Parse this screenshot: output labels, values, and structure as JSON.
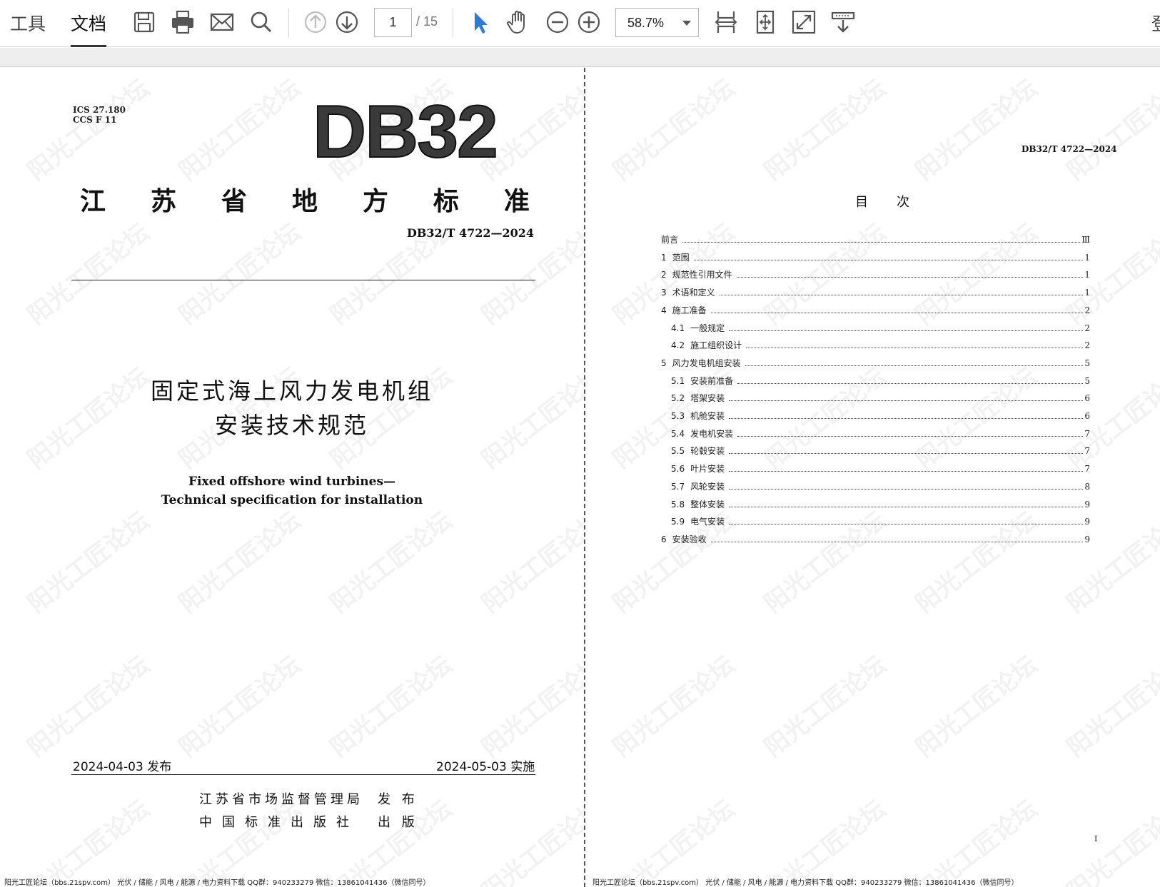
{
  "toolbar": {
    "tabs": [
      {
        "label": "工具",
        "active": false
      },
      {
        "label": "文档",
        "active": true
      }
    ],
    "icons": [
      "save-icon",
      "print-icon",
      "email-icon",
      "search-icon",
      "prev-page-icon",
      "next-page-icon",
      "select-tool-icon",
      "hand-tool-icon",
      "zoom-out-icon",
      "zoom-in-icon",
      "fit-width-icon",
      "fit-page-icon",
      "fullscreen-icon",
      "read-mode-icon"
    ],
    "page_current": "1",
    "page_total": "/ 15",
    "zoom": "58.7%",
    "cut_text": "登",
    "accent_color": "#2e7bd6"
  },
  "left_page": {
    "ics_line1": "ICS  27.180",
    "ics_line2": "CCS  F  11",
    "logo": "DB32",
    "province_chars": [
      "江",
      "苏",
      "省",
      "地",
      "方",
      "标",
      "准"
    ],
    "standard_no": "DB32/T 4722—2024",
    "cn_title_line1": "固定式海上风力发电机组",
    "cn_title_line2": "安装技术规范",
    "en_title_line1": "Fixed offshore wind turbines—",
    "en_title_line2": "Technical specification for installation",
    "issue_date": "2024-04-03 发布",
    "effective_date": "2024-05-03 实施",
    "publisher1_name": "江苏省市场监督管理局",
    "publisher1_role": "发  布",
    "publisher2_name": "中国标准出版社",
    "publisher2_role": "出  版",
    "footer": "阳光工匠论坛（bbs.21spv.com）    光伏 / 储能 / 风电 / 能源 / 电力资料下载    QQ群：940233279      微信：13861041436（微信同号）"
  },
  "right_page": {
    "standard_no": "DB32/T 4722—2024",
    "toc_title": "目次",
    "toc": [
      {
        "num": "",
        "label": "前言",
        "page": "Ⅲ",
        "indent": 0
      },
      {
        "num": "1",
        "label": "范围",
        "page": "1",
        "indent": 0
      },
      {
        "num": "2",
        "label": "规范性引用文件",
        "page": "1",
        "indent": 0
      },
      {
        "num": "3",
        "label": "术语和定义",
        "page": "1",
        "indent": 0
      },
      {
        "num": "4",
        "label": "施工准备",
        "page": "2",
        "indent": 0
      },
      {
        "num": "4.1",
        "label": "一般规定",
        "page": "2",
        "indent": 1
      },
      {
        "num": "4.2",
        "label": "施工组织设计",
        "page": "2",
        "indent": 1
      },
      {
        "num": "5",
        "label": "风力发电机组安装",
        "page": "5",
        "indent": 0
      },
      {
        "num": "5.1",
        "label": "安装前准备",
        "page": "5",
        "indent": 1
      },
      {
        "num": "5.2",
        "label": "塔架安装",
        "page": "6",
        "indent": 1
      },
      {
        "num": "5.3",
        "label": "机舱安装",
        "page": "6",
        "indent": 1
      },
      {
        "num": "5.4",
        "label": "发电机安装",
        "page": "7",
        "indent": 1
      },
      {
        "num": "5.5",
        "label": "轮毂安装",
        "page": "7",
        "indent": 1
      },
      {
        "num": "5.6",
        "label": "叶片安装",
        "page": "7",
        "indent": 1
      },
      {
        "num": "5.7",
        "label": "风轮安装",
        "page": "8",
        "indent": 1
      },
      {
        "num": "5.8",
        "label": "整体安装",
        "page": "9",
        "indent": 1
      },
      {
        "num": "5.9",
        "label": "电气安装",
        "page": "9",
        "indent": 1
      },
      {
        "num": "6",
        "label": "安装验收",
        "page": "9",
        "indent": 0
      }
    ],
    "page_number": "Ⅰ",
    "footer": "阳光工匠论坛（bbs.21spv.com）    光伏 / 储能 / 风电 / 能源 / 电力资料下载    QQ群：940233279      微信：13861041436（微信同号）"
  },
  "watermark_text": "阳光工匠论坛"
}
